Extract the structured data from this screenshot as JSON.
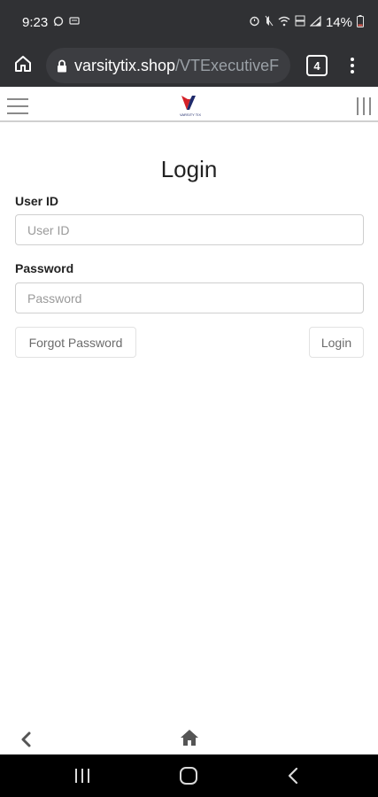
{
  "status_bar": {
    "time": "9:23",
    "battery": "14%",
    "icons": [
      "whatsapp-icon",
      "message-icon",
      "alarm-icon",
      "mute-icon",
      "wifi-icon",
      "volte-icon",
      "signal-icon",
      "battery-icon"
    ]
  },
  "browser": {
    "url_domain": "varsitytix.shop",
    "url_path": "/VTExecutiveF",
    "tab_count": "4"
  },
  "site_header": {
    "logo_text": "VARSITY TIX"
  },
  "login": {
    "title": "Login",
    "user_id_label": "User ID",
    "user_id_placeholder": "User ID",
    "user_id_value": "",
    "password_label": "Password",
    "password_placeholder": "Password",
    "password_value": "",
    "forgot_button": "Forgot Password",
    "login_button": "Login"
  },
  "colors": {
    "chrome_bg": "#303134",
    "url_pill": "#3c3d41",
    "logo_red": "#d42027",
    "logo_blue": "#1f2a6b"
  }
}
